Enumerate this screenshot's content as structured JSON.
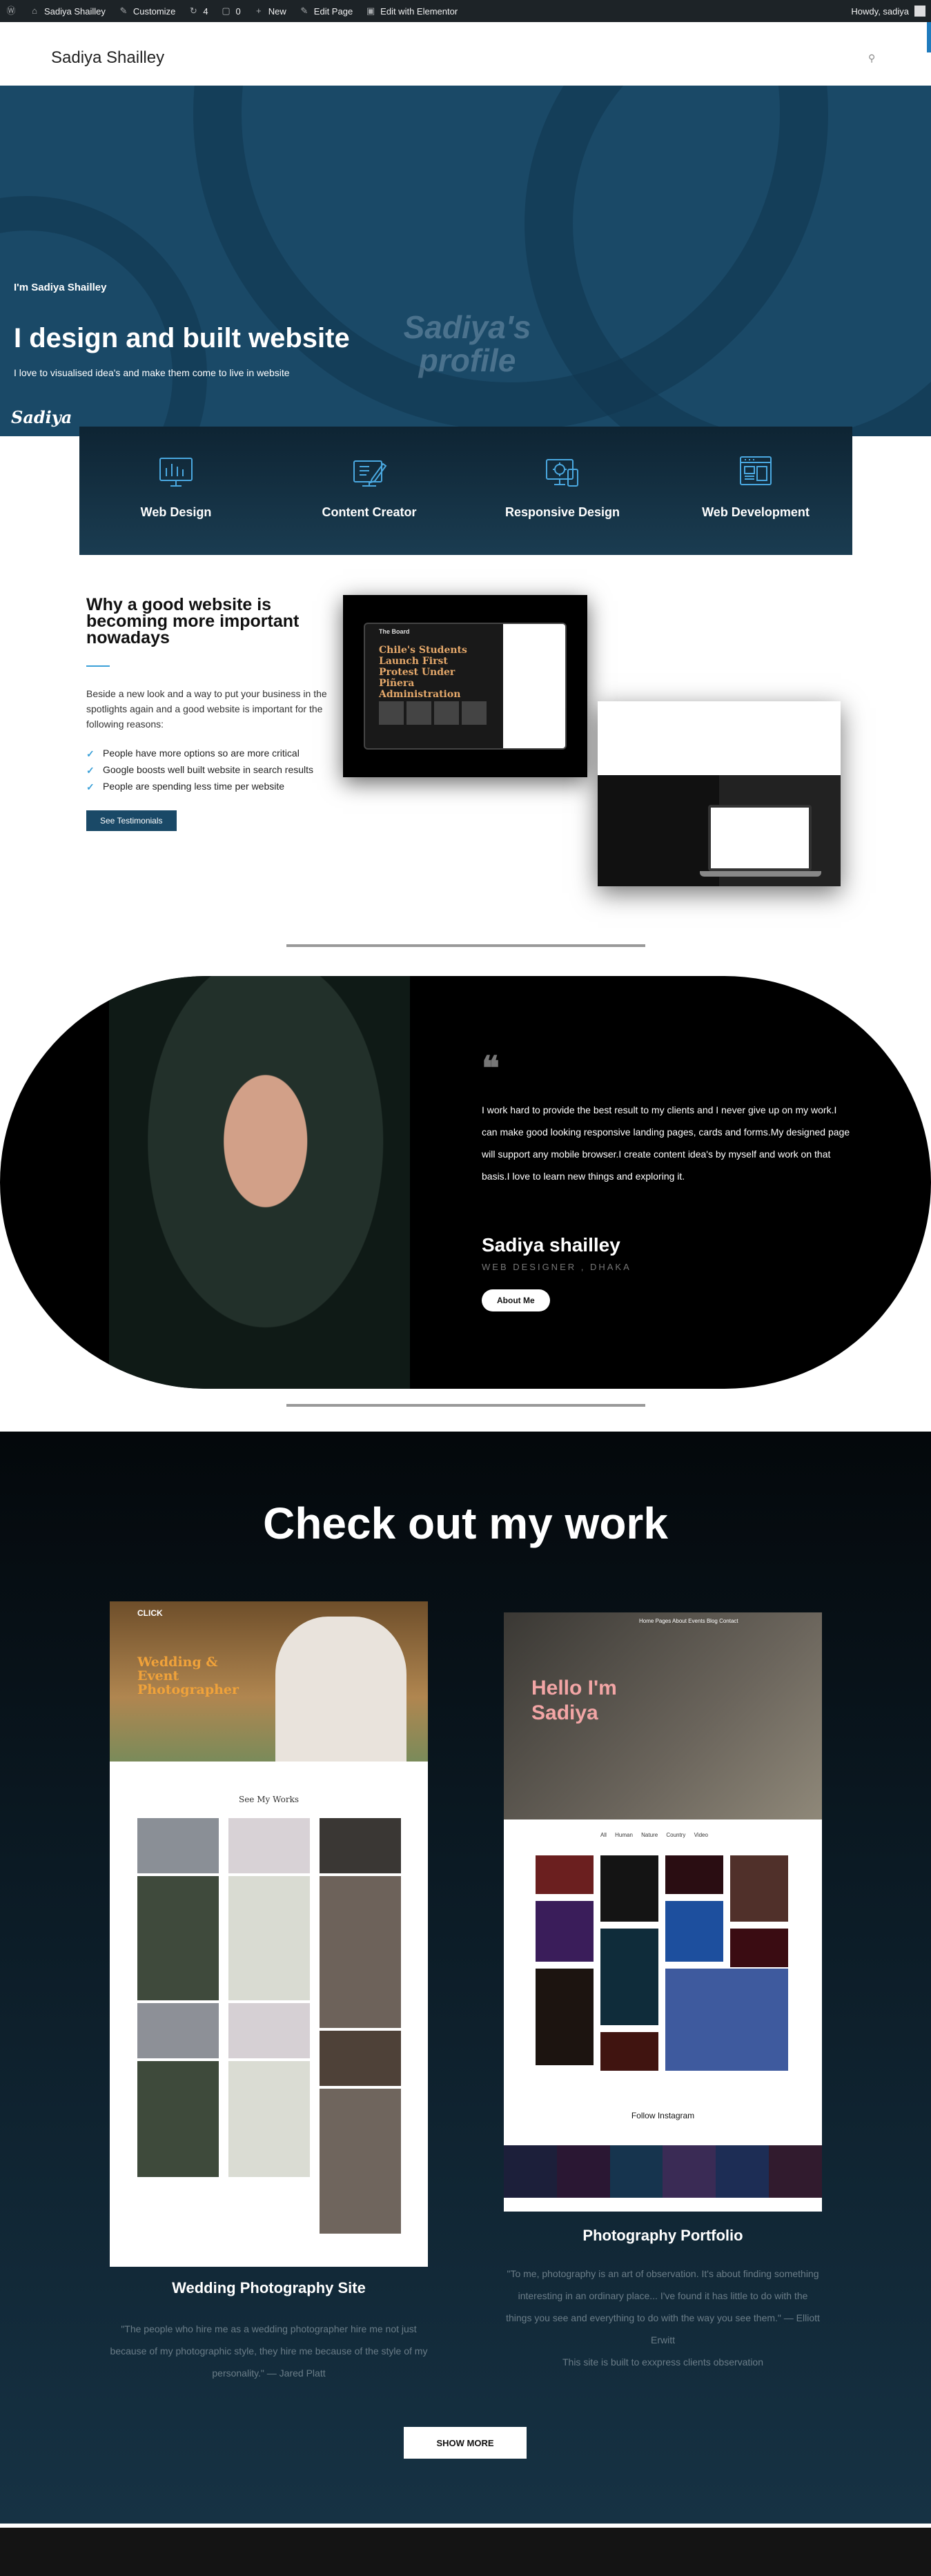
{
  "admin_bar": {
    "site": "Sadiya Shailley",
    "customize": "Customize",
    "updates": "4",
    "comments": "0",
    "new": "New",
    "edit_page": "Edit Page",
    "elementor": "Edit with Elementor",
    "howdy": "Howdy, sadiya"
  },
  "header": {
    "brand": "Sadiya Shailley"
  },
  "hero": {
    "pre_title": "I'm Sadiya Shailley",
    "title": "I design and built website",
    "subtitle": "I love to visualised idea's and make them come to live in website",
    "signature": "Sadiya",
    "watermark": "Sadiya's profile"
  },
  "services": [
    {
      "label": "Web Design",
      "icon": "web-design-icon"
    },
    {
      "label": "Content Creator",
      "icon": "content-creator-icon"
    },
    {
      "label": "Responsive Design",
      "icon": "responsive-design-icon"
    },
    {
      "label": "Web Development",
      "icon": "web-development-icon"
    }
  ],
  "why": {
    "title": "Why a good website is becoming more important nowadays",
    "body": "Beside a new look and a way to put your business in the spotlights again and a good website  is important for the following reasons:",
    "points": [
      "People have more options so are more critical",
      "Google boosts well built website in search results",
      "People are spending less time per website"
    ],
    "button": "See Testimonials",
    "mock_site": "The Board",
    "mock_headline": "Chile's Students Launch First Protest Under Piñera Administration"
  },
  "about": {
    "text": "I work hard to provide the best result to my clients and I never give up on my work.I can make good looking responsive landing pages, cards and forms.My designed page will support any mobile browser.I create content idea's by myself and work on that basis.I love to learn new things and exploring it.",
    "name": "Sadiya shailley",
    "role": "WEB DESIGNER , DHAKA",
    "button": "About Me"
  },
  "work": {
    "title": "Check out my work",
    "projects": [
      {
        "name": "Wedding Photography Site",
        "logo": "CLICK",
        "hero_title": "Wedding & Event Photographer",
        "gallery_title": "See My Works",
        "quote": "\"The people who hire me as a wedding photographer hire me not just because of my photographic style, they hire me because of the style of my personality.\" — Jared Platt"
      },
      {
        "name": "Photography Portfolio",
        "hero_title": "Hello I'm Sadiya",
        "menu": "Home Pages About Events Blog Contact",
        "tabs": "All Human Nature Country Video",
        "follow": "Follow Instagram",
        "quote": "\"To me, photography is an art of observation. It's about finding something interesting in an ordinary place... I've found it has little to do with the things you see and everything to do with the way you see them.\" — Elliott Erwitt",
        "note": "This site is built to exxpress clients observation"
      }
    ],
    "more_button": "SHOW MORE"
  }
}
